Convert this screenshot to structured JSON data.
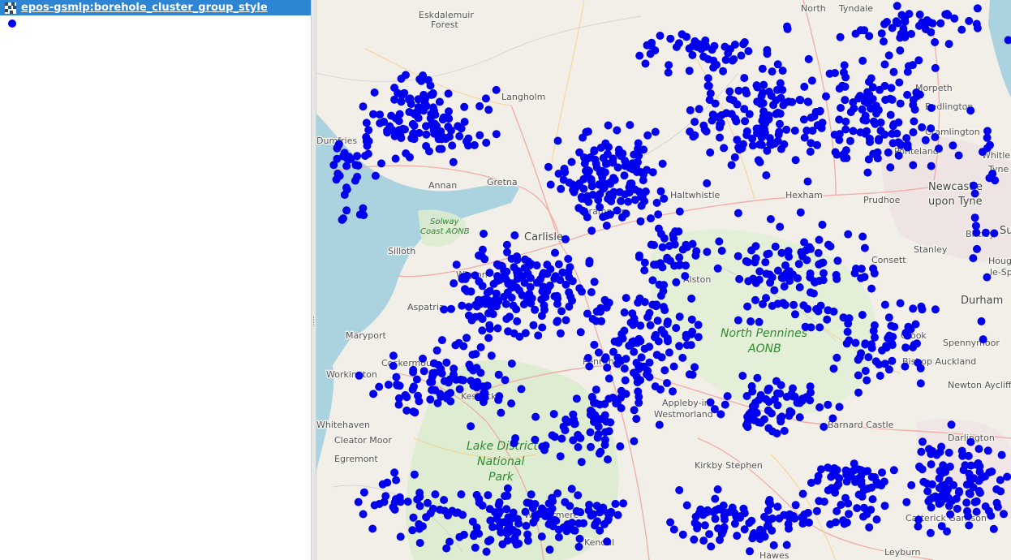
{
  "layer_panel": {
    "layer_name": "epos-gsmlp:borehole_cluster_group_style",
    "layer_icon": "layer-grid-icon",
    "legend_symbol": "blue-dot-icon",
    "legend_color": "#0000ee",
    "row_color": "#2d85d3"
  },
  "map": {
    "sea_color": "#aad3df",
    "land_color": "#f2efe9",
    "park_color": "#d6e8c6",
    "point_color": "#0000ee",
    "places": {
      "eskdalemuir": "Eskdalemuir",
      "forest": "Forest",
      "north": "North",
      "tyndale": "Tyndale",
      "langholm": "Langholm",
      "morpeth": "Morpeth",
      "bedlington": "Bedlington",
      "cramlington": "Cramlington",
      "whitley": "Whitle",
      "tyne": "Tyne",
      "ponteland": "Ponteland",
      "dumfries": "Dumfries",
      "annan": "Annan",
      "gretna": "Gretna",
      "brampton": "Brampton",
      "haltwhistle": "Haltwhistle",
      "hexham": "Hexham",
      "prudhoe": "Prudhoe",
      "newcastle": "Newcastle",
      "upon_tyne": "upon Tyne",
      "su": "Su",
      "solway": "Solway",
      "coast_aonb": "Coast AONB",
      "carlisle": "Carlisle",
      "birtley": "Birtley",
      "silloth": "Silloth",
      "stanley": "Stanley",
      "consett": "Consett",
      "houghton": "Houghto",
      "le_spring": "le-Sprin",
      "wigton": "Wigton",
      "alston": "Alston",
      "durham": "Durham",
      "aspatria": "Aspatria",
      "maryport": "Maryport",
      "north_pennines": "North Pennines",
      "aonb": "AONB",
      "crook": "Crook",
      "spennymoor": "Spennymoor",
      "cockermouth": "Cockermouth",
      "penrith": "Penrith",
      "bishop_auckland": "Bishop Auckland",
      "workington": "Workington",
      "newton_aycliffe": "Newton Aycliffe",
      "keswick": "Keswick",
      "appleby": "Appleby-in-",
      "westmorland": "Westmorland",
      "whitehaven": "Whitehaven",
      "barnard_castle": "Barnard Castle",
      "cleator_moor": "Cleator Moor",
      "lake_district": "Lake District",
      "national": "National",
      "park": "Park",
      "darlington": "Darlington",
      "egremont": "Egremont",
      "kirkby_stephen": "Kirkby Stephen",
      "windermere": "Windermere",
      "catterick": "Catterick Garrison",
      "kendal": "Kendal",
      "hawes": "Hawes",
      "leyburn": "Leyburn"
    }
  }
}
